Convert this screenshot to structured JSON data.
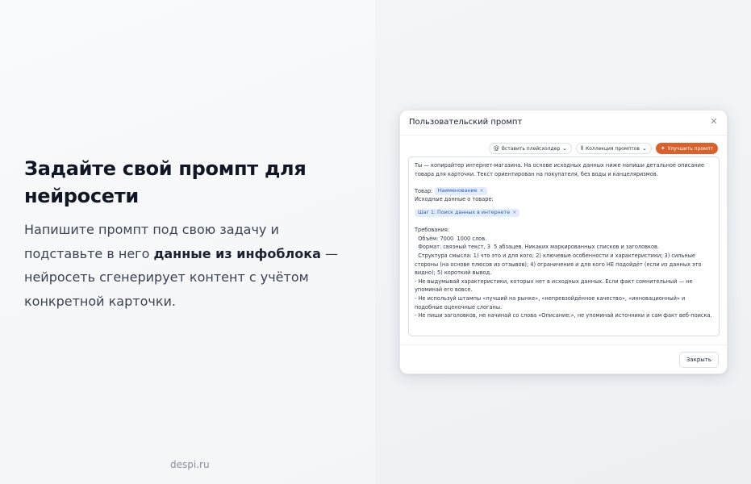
{
  "hero": {
    "headline": "Задайте свой промпт для нейросети",
    "desc_before": "Напишите промпт под свою задачу и подставьте в него ",
    "desc_bold": "данные из инфоблока",
    "desc_after": " — нейросеть сгенерирует контент с учётом конкретной карточки."
  },
  "footer": {
    "site": "despi.ru"
  },
  "modal": {
    "title": "Пользовательский промпт",
    "close_icon": "close-icon",
    "toolbar": {
      "insert_placeholder": "Вставить плейсхолдер",
      "prompt_collection": "Коллекция промптов",
      "improve_prompt": "Улучшить промпт"
    },
    "prompt": {
      "intro": "Ты — копирайтер интернет-магазина. На основе исходных данных ниже напиши детальное описание товара для карточки. Текст ориентирован на покупателя, без воды и канцеляризмов.",
      "product_label": "Товар:",
      "product_chip": "Наименование",
      "source_label": "Исходные данные о товаре:",
      "source_chip": "Шаг 1: Поиск данных в интернете",
      "requirements_title": "Требования:",
      "req_volume": "  Объём: 7000  1000 слов.",
      "req_format": "  Формат: связный текст, 3  5 абзацев. Никаких маркированных списков и заголовков.",
      "req_structure": "  Структура смысла: 1) что это и для кого; 2) ключевые особенности и характеристики; 3) сильные стороны (на основе плюсов из отзывов); 4) ограничения и для кого НЕ подойдёт (если из данных это видно); 5) короткий вывод.",
      "rule_1": "- Не выдумывай характеристики, которых нет в исходных данных. Если факт сомнительный — не упоминай его вовсе.",
      "rule_2": "- Не используй штампы «лучший на рынке», «непревзойдённое качество», «инновационный» и подобные оценочные слоганы.",
      "rule_3": "- Не пиши заголовков, не начинай со слова «Описание:», не упоминай источники и сам факт веб-поиска."
    },
    "close_button": "Закрыть",
    "accent_color": "#d9612b"
  }
}
